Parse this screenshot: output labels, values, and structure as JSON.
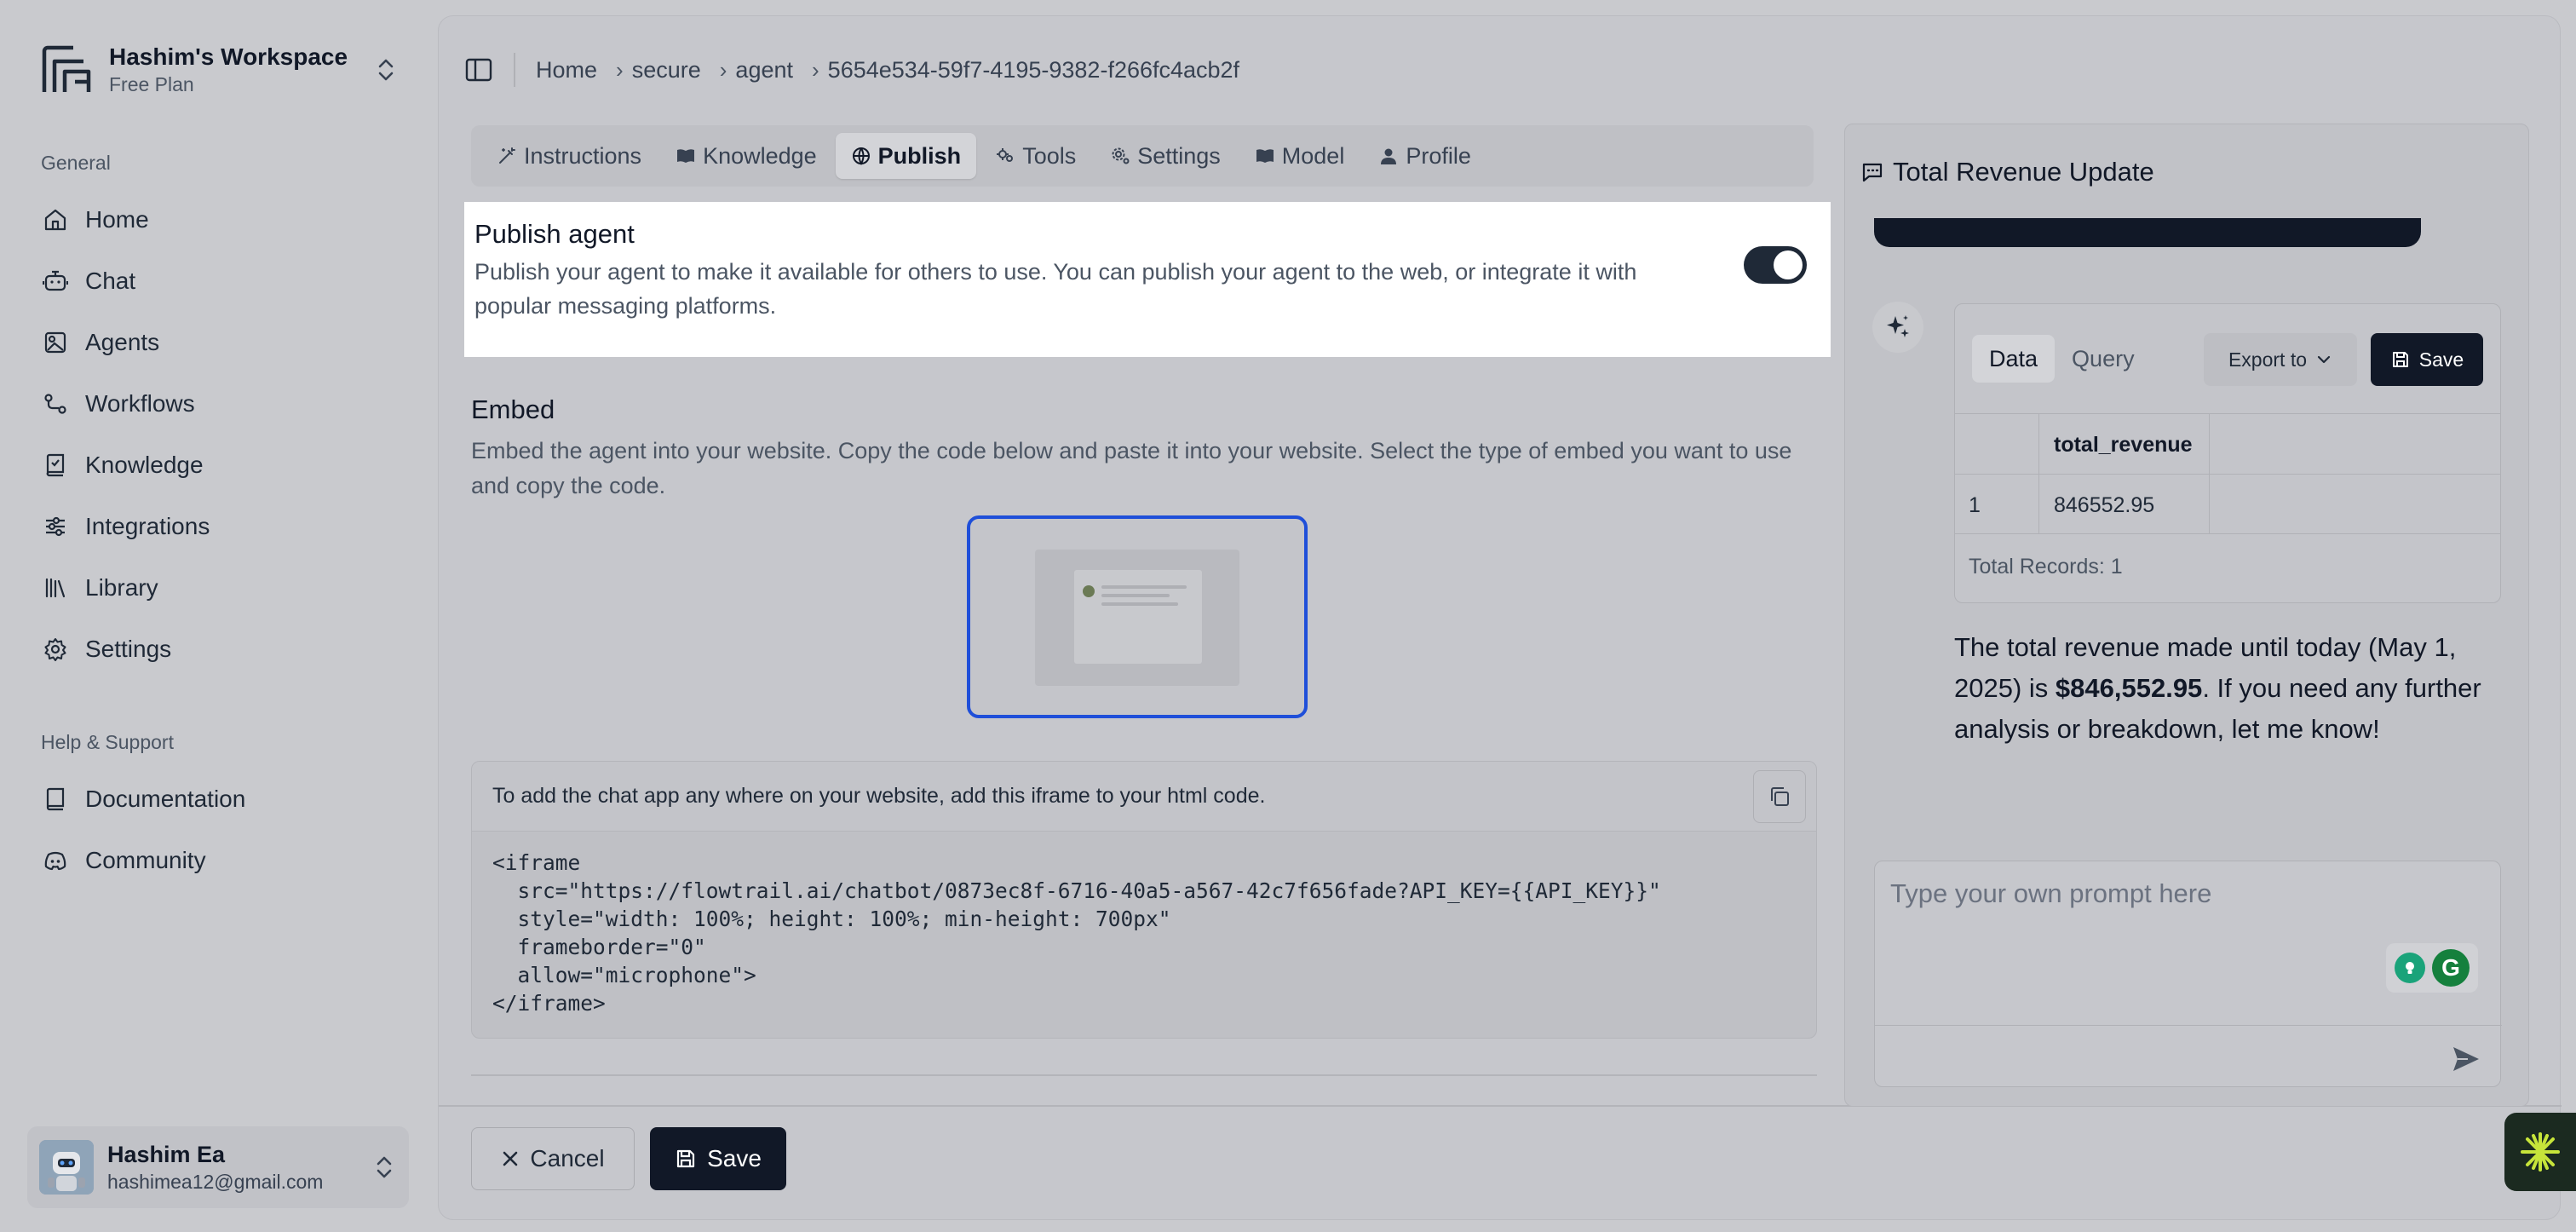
{
  "workspace": {
    "name": "Hashim's Workspace",
    "plan": "Free Plan"
  },
  "sidebar": {
    "general_label": "General",
    "items": [
      {
        "label": "Home",
        "icon": "home-icon"
      },
      {
        "label": "Chat",
        "icon": "bot-icon"
      },
      {
        "label": "Agents",
        "icon": "agents-icon"
      },
      {
        "label": "Workflows",
        "icon": "workflow-icon"
      },
      {
        "label": "Knowledge",
        "icon": "book-check-icon"
      },
      {
        "label": "Integrations",
        "icon": "sliders-icon"
      },
      {
        "label": "Library",
        "icon": "library-icon"
      },
      {
        "label": "Settings",
        "icon": "gear-icon"
      }
    ],
    "help_label": "Help & Support",
    "help_items": [
      {
        "label": "Documentation",
        "icon": "book-icon"
      },
      {
        "label": "Community",
        "icon": "discord-icon"
      }
    ]
  },
  "user": {
    "name": "Hashim Ea",
    "email": "hashimea12@gmail.com"
  },
  "breadcrumb": {
    "home": "Home",
    "items": [
      "secure",
      "agent",
      "5654e534-59f7-4195-9382-f266fc4acb2f"
    ]
  },
  "tabs": {
    "active": "Publish",
    "items": [
      {
        "label": "Instructions",
        "icon": "wand-icon"
      },
      {
        "label": "Knowledge",
        "icon": "book-open-icon"
      },
      {
        "label": "Publish",
        "icon": "globe-icon"
      },
      {
        "label": "Tools",
        "icon": "tools-icon"
      },
      {
        "label": "Settings",
        "icon": "settings-icon"
      },
      {
        "label": "Model",
        "icon": "book-open-icon"
      },
      {
        "label": "Profile",
        "icon": "user-icon"
      }
    ]
  },
  "publish": {
    "title": "Publish agent",
    "description": "Publish your agent to make it available for others to use. You can publish your agent to the web, or integrate it with popular messaging platforms.",
    "enabled": true
  },
  "embed": {
    "title": "Embed",
    "description": "Embed the agent into your website. Copy the code below and paste it into your website. Select the type of embed you want to use and copy the code.",
    "code_instruction": "To add the chat app any where on your website, add this iframe to your html code.",
    "code": "<iframe\n  src=\"https://flowtrail.ai/chatbot/0873ec8f-6716-40a5-a567-42c7f656fade?API_KEY={{API_KEY}}\"\n  style=\"width: 100%; height: 100%; min-height: 700px\"\n  frameborder=\"0\"\n  allow=\"microphone\">\n</iframe>"
  },
  "footer": {
    "cancel_label": "Cancel",
    "save_label": "Save"
  },
  "chat": {
    "title": "Total Revenue Update",
    "result": {
      "data_tab": "Data",
      "query_tab": "Query",
      "export_label": "Export to",
      "save_label": "Save",
      "column": "total_revenue",
      "rows": [
        {
          "index": "1",
          "value": "846552.95"
        }
      ],
      "total_records": "Total Records: 1"
    },
    "answer_prefix": "The total revenue made until today (May 1, 2025) is ",
    "answer_bold": "$846,552.95",
    "answer_suffix": ". If you need any further analysis or breakdown, let me know!",
    "prompt_placeholder": "Type your own prompt here"
  },
  "colors": {
    "accent": "#111827",
    "selection": "#1f4fd9",
    "grammarly": "#15803d"
  }
}
